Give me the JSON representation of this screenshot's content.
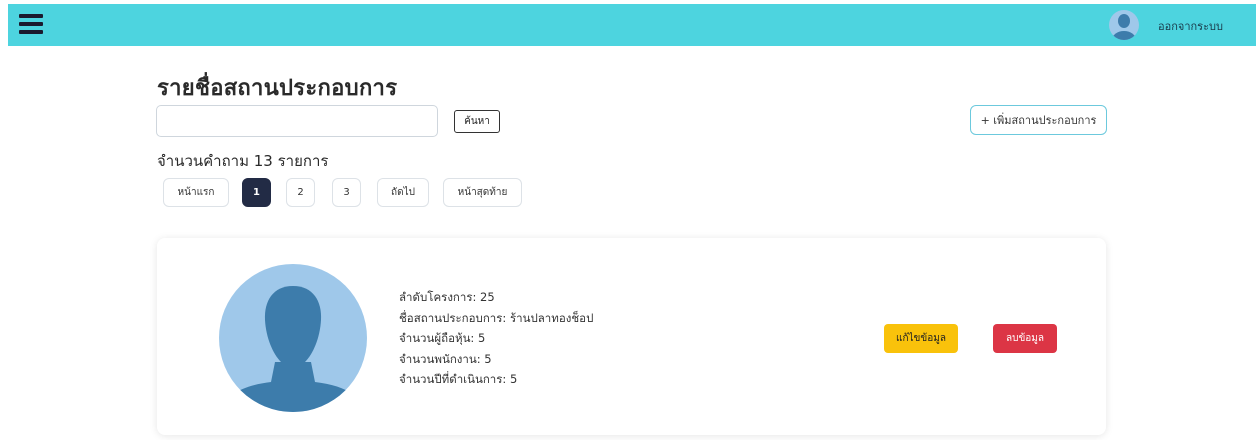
{
  "header": {
    "menu_icon": "hamburger-menu-icon",
    "avatar_icon": "user-avatar-icon",
    "logout_label": "ออกจากระบบ",
    "bar_color": "#4dd4df"
  },
  "page": {
    "title": "รายชื่อสถานประกอบการ"
  },
  "search": {
    "value": "",
    "placeholder": "",
    "button_label": "ค้นหา"
  },
  "add_button_label": "+ เพิ่มสถานประกอบการ",
  "results": {
    "count_label": "จำนวนคำถาม 13 รายการ"
  },
  "pagination": {
    "first_label": "หน้าแรก",
    "pages": [
      "1",
      "2",
      "3"
    ],
    "active_page": "1",
    "next_label": "ถัดไป",
    "last_label": "หน้าสุดท้าย"
  },
  "records": [
    {
      "avatar_icon": "person-placeholder-icon",
      "project_order": "ลำดับโครงการ: 25",
      "business_name": "ชื่อสถานประกอบการ: ร้านปลาทองช็อป",
      "shareholders": "จำนวนผู้ถือหุ้น: 5",
      "employees": "จำนวนพนักงาน: 5",
      "years_in_operation": "จำนวนปีที่ดำเนินการ: 5",
      "edit_label": "แก้ไขข้อมูล",
      "delete_label": "ลบข้อมูล"
    }
  ],
  "colors": {
    "edit": "#f9c20b",
    "delete": "#dc3545",
    "active_page": "#222b45"
  }
}
